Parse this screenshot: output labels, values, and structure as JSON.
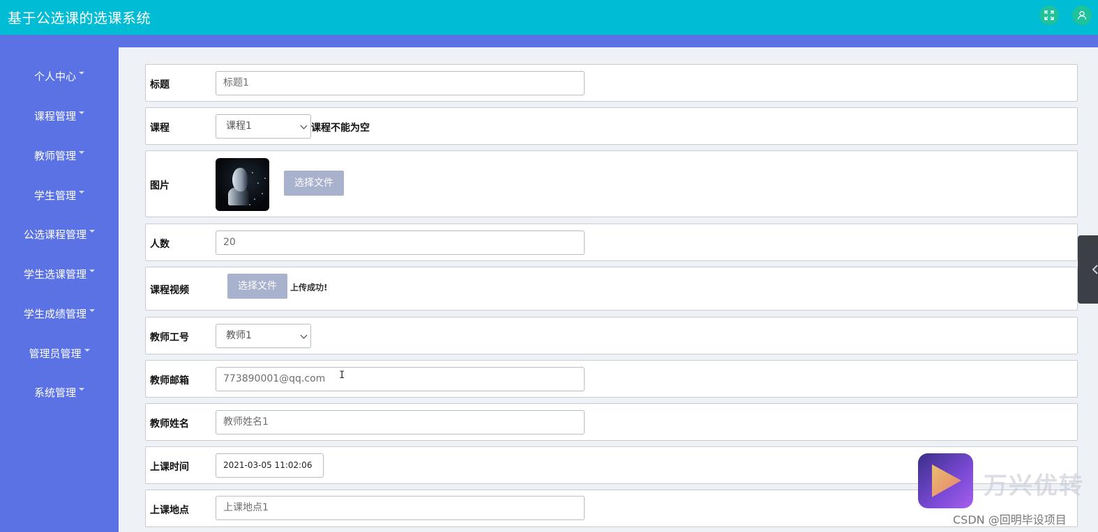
{
  "app": {
    "title": "基于公选课的选课系统"
  },
  "topbar": {
    "icons": [
      "expand-icon",
      "user-icon"
    ]
  },
  "sidebar": {
    "items": [
      {
        "label": "个人中心"
      },
      {
        "label": "课程管理"
      },
      {
        "label": "教师管理"
      },
      {
        "label": "学生管理"
      },
      {
        "label": "公选课程管理"
      },
      {
        "label": "学生选课管理"
      },
      {
        "label": "学生成绩管理"
      },
      {
        "label": "管理员管理"
      },
      {
        "label": "系统管理"
      }
    ]
  },
  "form": {
    "title": {
      "label": "标题",
      "value": "标题1"
    },
    "course": {
      "label": "课程",
      "selected": "课程1",
      "validation": "课程不能为空"
    },
    "image": {
      "label": "图片",
      "button": "选择文件"
    },
    "capacity": {
      "label": "人数",
      "value": "20"
    },
    "video": {
      "label": "课程视频",
      "button": "选择文件",
      "status": "上传成功!"
    },
    "teacher_id": {
      "label": "教师工号",
      "selected": "教师1"
    },
    "teacher_email": {
      "label": "教师邮箱",
      "value": "773890001@qq.com"
    },
    "teacher_name": {
      "label": "教师姓名",
      "value": "教师姓名1"
    },
    "class_time": {
      "label": "上课时间",
      "value": "2021-03-05 11:02:06"
    },
    "location": {
      "label": "上课地点",
      "value": "上课地点1"
    }
  },
  "overlay": {
    "watermark_text": "万兴优转",
    "credit": "CSDN @回明毕设项目"
  }
}
